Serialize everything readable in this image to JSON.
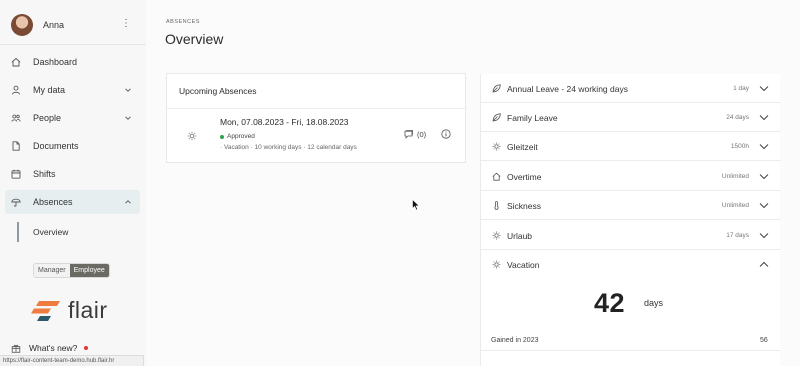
{
  "user": {
    "name": "Anna"
  },
  "nav": {
    "items": [
      {
        "label": "Dashboard"
      },
      {
        "label": "My data"
      },
      {
        "label": "People"
      },
      {
        "label": "Documents"
      },
      {
        "label": "Shifts"
      },
      {
        "label": "Absences"
      }
    ],
    "subitem": "Overview"
  },
  "role_toggle": {
    "manager": "Manager",
    "employee": "Employee"
  },
  "logo": {
    "text": "flair"
  },
  "whats_new": "What's new?",
  "status_url": "https://flair-content-team-demo.hub.flair.hr",
  "page": {
    "eyebrow": "ABSENCES",
    "title": "Overview"
  },
  "upcoming": {
    "title": "Upcoming Absences",
    "date_range": "Mon, 07.08.2023 - Fri, 18.08.2023",
    "status": "Approved",
    "details": "· Vacation · 10 working days · 12 calendar days",
    "comments": "(0)"
  },
  "categories": [
    {
      "name": "Annual Leave - 24 working days",
      "value": "1 day",
      "icon": "leaf-icon",
      "expanded": false
    },
    {
      "name": "Family Leave",
      "value": "24 days",
      "icon": "leaf-icon",
      "expanded": false
    },
    {
      "name": "Gleitzeit",
      "value": "1500h",
      "icon": "sun-icon",
      "expanded": false
    },
    {
      "name": "Overtime",
      "value": "Unlimited",
      "icon": "home-icon",
      "expanded": false
    },
    {
      "name": "Sickness",
      "value": "Unlimited",
      "icon": "thermometer-icon",
      "expanded": false
    },
    {
      "name": "Urlaub",
      "value": "17 days",
      "icon": "sun-icon",
      "expanded": false
    },
    {
      "name": "Vacation",
      "value": "",
      "icon": "sun-icon",
      "expanded": true
    }
  ],
  "vacation_detail": {
    "balance": "42",
    "unit": "days",
    "gained_label": "Gained in 2023",
    "gained_value": "56"
  },
  "colors": {
    "accent_bg": "#e6eef0",
    "approved": "#2ea24e",
    "logo_orange": "#f07b3f",
    "logo_teal": "#2c5a6b"
  }
}
